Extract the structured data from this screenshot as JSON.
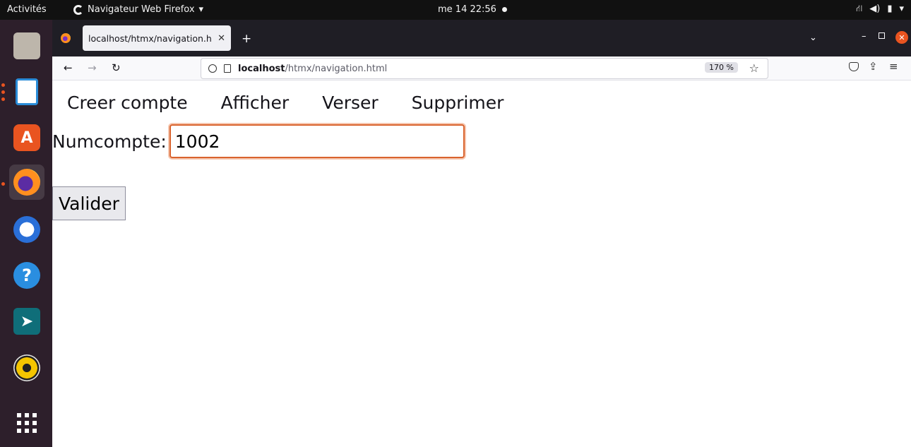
{
  "system": {
    "activities": "Activités",
    "app_menu": "Navigateur Web Firefox",
    "clock": "me 14 22:56"
  },
  "browser": {
    "tab_title": "localhost/htmx/navigation.h",
    "url_host": "localhost",
    "url_path": "/htmx/navigation.html",
    "zoom": "170 %"
  },
  "page": {
    "nav": [
      "Creer compte",
      "Afficher",
      "Verser",
      "Supprimer"
    ],
    "field_label": "Numcompte:",
    "field_value": "1002",
    "submit_label": "Valider"
  },
  "colors": {
    "input_focus_border": "#d9632e",
    "dock_bg": "#2d1f2b",
    "accent": "#e95420"
  }
}
